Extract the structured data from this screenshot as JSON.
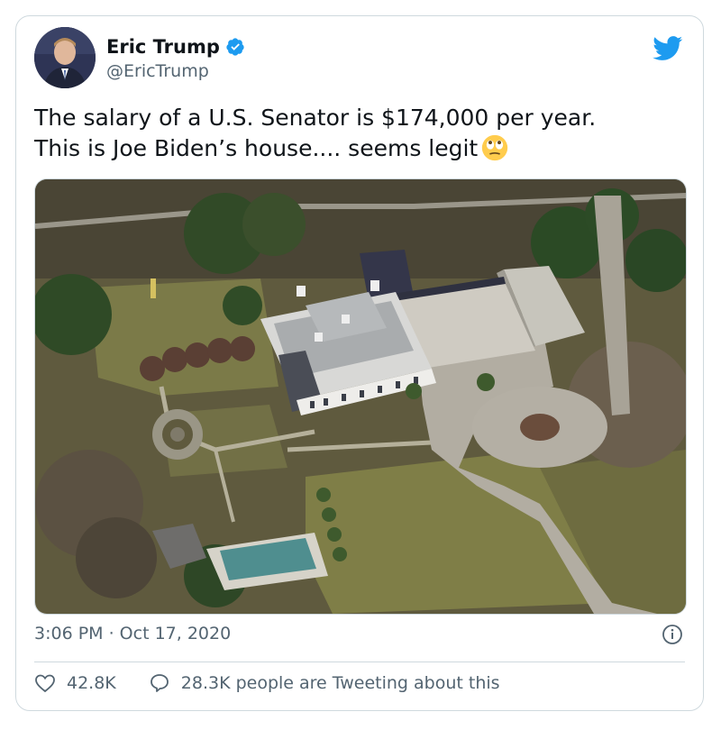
{
  "tweet": {
    "author_name": "Eric Trump",
    "handle": "@EricTrump",
    "verified": true,
    "text_line1": "The salary of a U.S. Senator is $174,000 per year.",
    "text_line2": "This is Joe Biden’s house.... seems legit",
    "emoji": "face-with-rolling-eyes-icon",
    "timestamp": "3:06 PM · Oct 17, 2020"
  },
  "actions": {
    "likes": "42.8K",
    "tweeting": "28.3K people are Tweeting about this"
  },
  "colors": {
    "text": "#0f1419",
    "secondary": "#536471",
    "accent": "#1d9bf0",
    "border": "#cfd9de"
  },
  "icons": [
    "verified-badge-icon",
    "twitter-bird-icon",
    "info-icon",
    "heart-icon",
    "reply-bubble-icon"
  ]
}
